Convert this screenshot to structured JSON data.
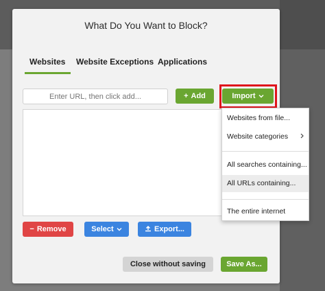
{
  "dialog": {
    "title": "What Do You Want to Block?"
  },
  "tabs": [
    {
      "label": "Websites",
      "active": true
    },
    {
      "label": "Website Exceptions",
      "active": false
    },
    {
      "label": "Applications",
      "active": false
    }
  ],
  "url_input": {
    "placeholder": "Enter URL, then click add..."
  },
  "buttons": {
    "add": "Add",
    "import": "Import",
    "remove": "Remove",
    "select": "Select",
    "export": "Export...",
    "close_without_saving": "Close without saving",
    "save_as": "Save As..."
  },
  "import_menu": {
    "items": [
      {
        "label": "Websites from file..."
      },
      {
        "label": "Website categories"
      },
      {
        "label": "All searches containing..."
      },
      {
        "label": "All URLs containing...",
        "highlighted": true
      },
      {
        "label": "The entire internet"
      }
    ]
  },
  "colors": {
    "accent_green": "#6aa631",
    "remove_red": "#e04545",
    "blue": "#3b84e0",
    "highlight_outline": "#e0141c"
  },
  "icons": {
    "add": "plus-icon",
    "import": "chevron-down-icon",
    "remove": "minus-icon",
    "select": "chevron-down-icon",
    "export": "upload-icon",
    "submenu": "chevron-right-icon"
  }
}
